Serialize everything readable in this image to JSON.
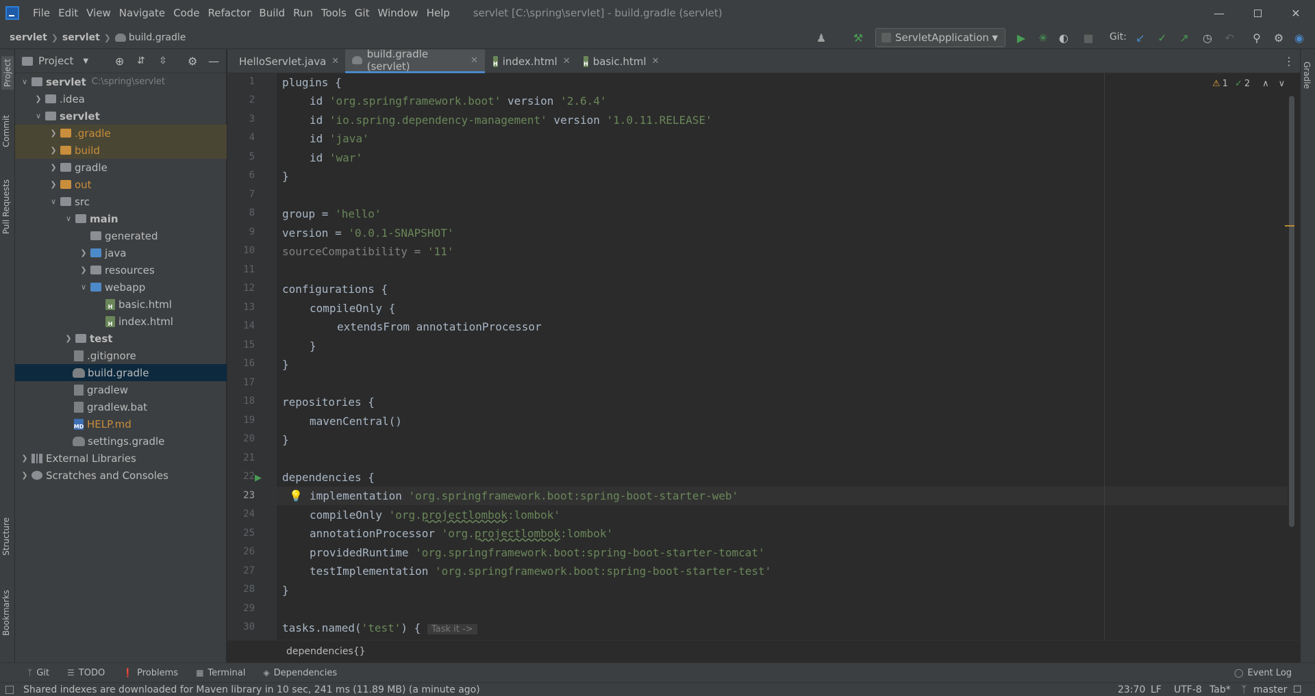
{
  "title_bar": {
    "menu": [
      "File",
      "Edit",
      "View",
      "Navigate",
      "Code",
      "Refactor",
      "Build",
      "Run",
      "Tools",
      "Git",
      "Window",
      "Help"
    ],
    "window_title": "servlet [C:\\spring\\servlet] - build.gradle (servlet)"
  },
  "nav_bar": {
    "breadcrumbs": [
      "servlet",
      "servlet",
      "build.gradle"
    ],
    "run_config": "ServletApplication",
    "git_label": "Git:"
  },
  "left_stripe": [
    "Project",
    "Commit",
    "Pull Requests",
    "Structure",
    "Bookmarks"
  ],
  "right_stripe": [
    "Gradle"
  ],
  "project_panel": {
    "title": "Project",
    "tree": [
      {
        "label": "servlet",
        "extra": "C:\\spring\\servlet"
      },
      {
        "label": ".idea"
      },
      {
        "label": "servlet"
      },
      {
        "label": ".gradle"
      },
      {
        "label": "build"
      },
      {
        "label": "gradle"
      },
      {
        "label": "out"
      },
      {
        "label": "src"
      },
      {
        "label": "main"
      },
      {
        "label": "generated"
      },
      {
        "label": "java"
      },
      {
        "label": "resources"
      },
      {
        "label": "webapp"
      },
      {
        "label": "basic.html"
      },
      {
        "label": "index.html"
      },
      {
        "label": "test"
      },
      {
        "label": ".gitignore"
      },
      {
        "label": "build.gradle"
      },
      {
        "label": "gradlew"
      },
      {
        "label": "gradlew.bat"
      },
      {
        "label": "HELP.md"
      },
      {
        "label": "settings.gradle"
      },
      {
        "label": "External Libraries"
      },
      {
        "label": "Scratches and Consoles"
      }
    ]
  },
  "tabs": [
    {
      "label": "HelloServlet.java"
    },
    {
      "label": "build.gradle (servlet)"
    },
    {
      "label": "index.html"
    },
    {
      "label": "basic.html"
    }
  ],
  "editor": {
    "line_numbers": [
      "1",
      "2",
      "3",
      "4",
      "5",
      "6",
      "7",
      "8",
      "9",
      "10",
      "11",
      "12",
      "13",
      "14",
      "15",
      "16",
      "17",
      "18",
      "19",
      "20",
      "21",
      "22",
      "23",
      "24",
      "25",
      "26",
      "27",
      "28",
      "29",
      "30"
    ],
    "inspections": {
      "warnings": "1",
      "weak_warnings": "2"
    },
    "code": {
      "l1": "plugins {",
      "l2_id": "id ",
      "l2_s": "'org.springframework.boot'",
      "l2_v": " version ",
      "l2_vs": "'2.6.4'",
      "l3_id": "id ",
      "l3_s": "'io.spring.dependency-management'",
      "l3_v": " version ",
      "l3_vs": "'1.0.11.RELEASE'",
      "l4_id": "id ",
      "l4_s": "'java'",
      "l5_id": "id ",
      "l5_s": "'war'",
      "l6": "}",
      "l8_a": "group = ",
      "l8_s": "'hello'",
      "l9_a": "version = ",
      "l9_s": "'0.0.1-SNAPSHOT'",
      "l10_a": "sourceCompatibility = ",
      "l10_s": "'11'",
      "l12": "configurations {",
      "l13": "compileOnly {",
      "l14": "extendsFrom annotationProcessor",
      "l15": "}",
      "l16": "}",
      "l18": "repositories {",
      "l19": "mavenCentral()",
      "l20": "}",
      "l22": "dependencies {",
      "l23_a": "implementation ",
      "l23_s": "'org.springframework.boot:spring-boot-starter-web'",
      "l24_a": "compileOnly ",
      "l24_s1": "'org.",
      "l24_u": "projectlombok",
      "l24_s2": ":lombok'",
      "l25_a": "annotationProcessor ",
      "l25_s1": "'org.",
      "l25_u": "projectlombok",
      "l25_s2": ":lombok'",
      "l26_a": "providedRuntime ",
      "l26_s": "'org.springframework.boot:spring-boot-starter-tomcat'",
      "l27_a": "testImplementation ",
      "l27_s": "'org.springframework.boot:spring-boot-starter-test'",
      "l28": "}",
      "l30_a": "tasks.named(",
      "l30_s": "'test'",
      "l30_b": ") {",
      "l30_hint": "Task it ->"
    },
    "breadcrumb": "dependencies{}"
  },
  "tool_windows": [
    "Git",
    "TODO",
    "Problems",
    "Terminal",
    "Dependencies"
  ],
  "event_log": "Event Log",
  "status_bar": {
    "message": "Shared indexes are downloaded for Maven library in 10 sec, 241 ms (11.89 MB) (a minute ago)",
    "position": "23:70",
    "line_sep": "LF",
    "encoding": "UTF-8",
    "indent": "Tab*",
    "branch": "master"
  },
  "colors": {
    "accent": "#4a88c7",
    "string": "#6a8759",
    "code": "#a9b7c6",
    "run_green": "#499c54"
  }
}
